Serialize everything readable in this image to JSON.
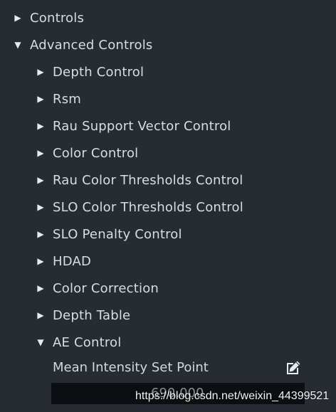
{
  "tree": {
    "controls": {
      "label": "Controls",
      "arrow": "▶"
    },
    "advanced_controls": {
      "label": "Advanced Controls",
      "arrow": "▼"
    },
    "items": [
      {
        "label": "Depth Control",
        "arrow": "▶"
      },
      {
        "label": "Rsm",
        "arrow": "▶"
      },
      {
        "label": "Rau Support Vector Control",
        "arrow": "▶"
      },
      {
        "label": "Color Control",
        "arrow": "▶"
      },
      {
        "label": "Rau Color Thresholds Control",
        "arrow": "▶"
      },
      {
        "label": "SLO Color Thresholds Control",
        "arrow": "▶"
      },
      {
        "label": "SLO Penalty Control",
        "arrow": "▶"
      },
      {
        "label": "HDAD",
        "arrow": "▶"
      },
      {
        "label": "Color Correction",
        "arrow": "▶"
      },
      {
        "label": "Depth Table",
        "arrow": "▶"
      },
      {
        "label": "AE Control",
        "arrow": "▼"
      }
    ]
  },
  "ae_control": {
    "param_label": "Mean Intensity Set Point",
    "value": "690.000",
    "edit_icon": "edit-icon"
  },
  "watermark": "https://blog.csdn.net/weixin_44399521",
  "colors": {
    "background": "#272c32",
    "text": "#d8dde2",
    "value_box": "#0c0f12"
  }
}
